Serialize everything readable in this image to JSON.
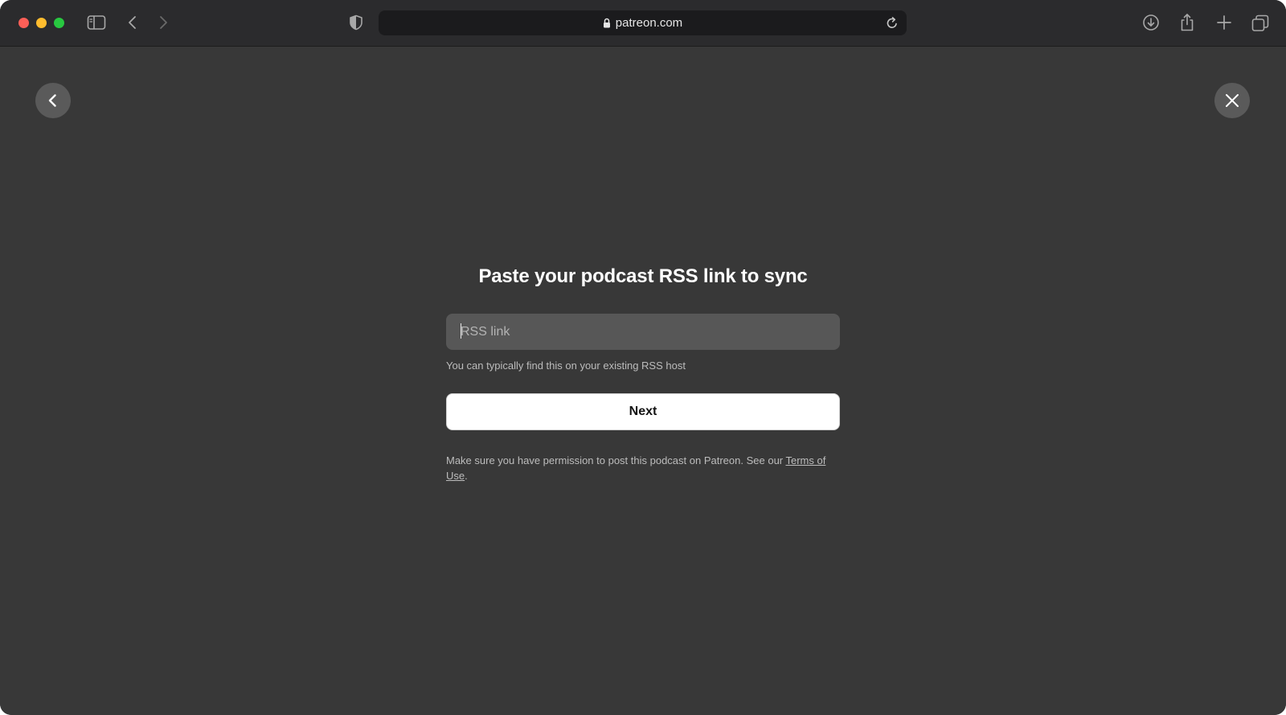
{
  "browser": {
    "url": "patreon.com"
  },
  "page": {
    "title": "Paste your podcast RSS link to sync",
    "input": {
      "placeholder": "RSS link",
      "value": ""
    },
    "hint": "You can typically find this on your existing RSS host",
    "next_label": "Next",
    "legal": {
      "prefix": "Make sure you have permission to post this podcast on Patreon. See our ",
      "link_text": "Terms of Use",
      "suffix": "."
    }
  },
  "colors": {
    "page_background": "#383838",
    "toolbar_background": "#2b2b2d",
    "input_background": "#575757",
    "button_background": "#ffffff"
  }
}
